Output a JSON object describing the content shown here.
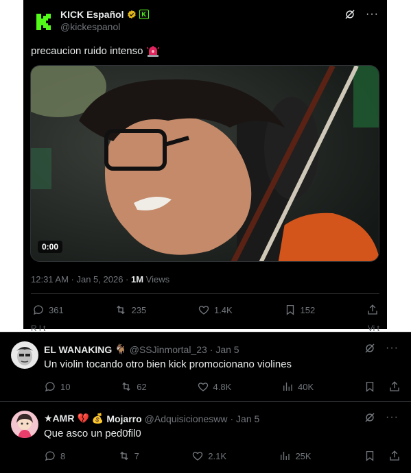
{
  "main_tweet": {
    "author_name": "KICK Español",
    "handle": "@kickespanol",
    "text": "precaucion ruido intenso",
    "video_time": "0:00",
    "timestamp": "12:31 AM · Jan 5, 2026 · ",
    "views_count": "1M",
    "views_label": " Views",
    "stats": {
      "replies": "361",
      "reposts": "235",
      "likes": "1.4K",
      "bookmarks": "152"
    },
    "cut_text_left": "R l   t",
    "cut_text_right": "Vi      t"
  },
  "replies": [
    {
      "name": "EL WANAKING",
      "name_emoji": "🐐",
      "handle": "@SSJinmortal_23",
      "date": "· Jan 5",
      "text": "Un violin tocando otro bien kick promocionano violines",
      "replies": "10",
      "reposts": "62",
      "likes": "4.8K",
      "views": "40K"
    },
    {
      "name_prefix": "★AMR",
      "name_emoji1": "💔",
      "name_emoji2": "💰",
      "name": "Mojarro",
      "handle": "@Adquisicionesww",
      "date": "· Jan 5",
      "text": "Que asco un ped0fil0",
      "replies": "8",
      "reposts": "7",
      "likes": "2.1K",
      "views": "25K"
    }
  ],
  "colors": {
    "background": "#000000",
    "text_primary": "#e7e9ea",
    "text_secondary": "#71767b",
    "divider": "#2f3336",
    "kick_green": "#53fc18",
    "verified_gold": "#e2b719"
  }
}
